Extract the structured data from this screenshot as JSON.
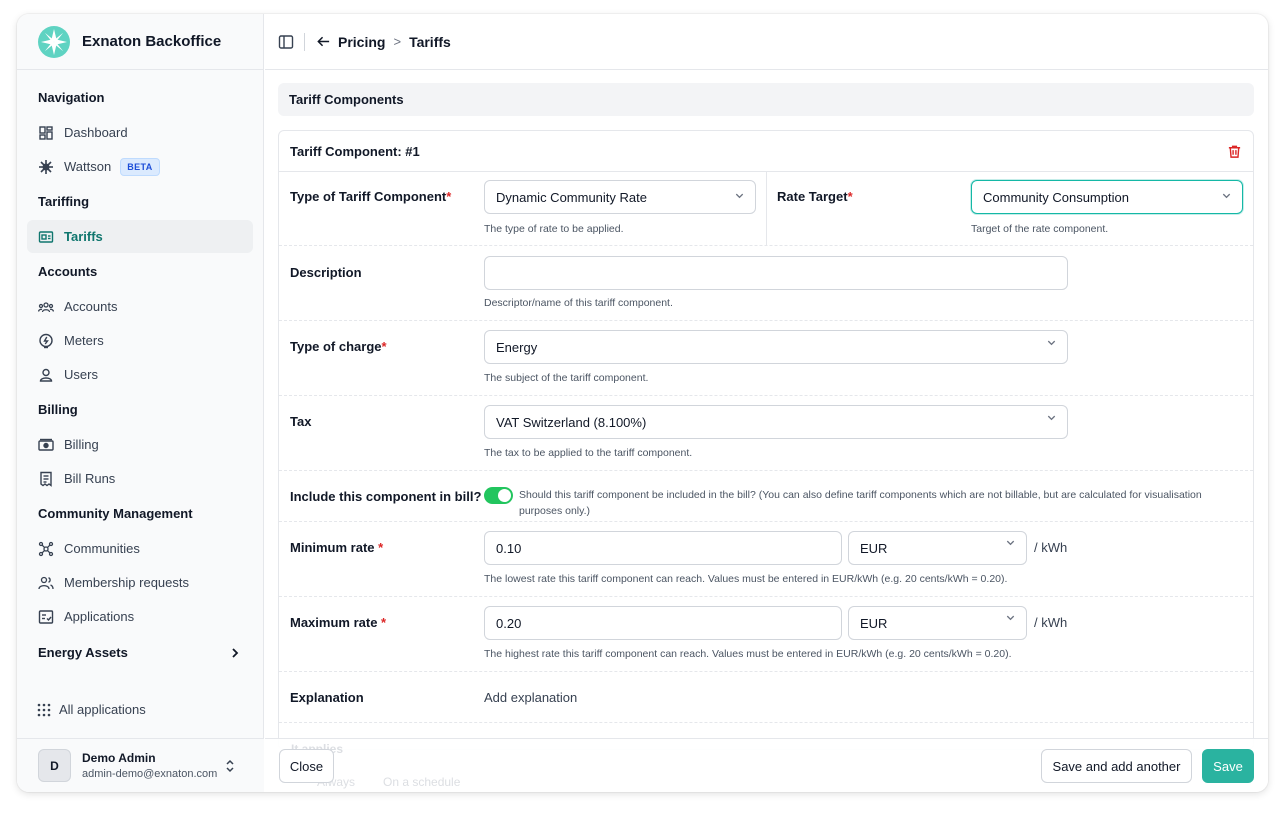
{
  "brand": {
    "name": "Exnaton Backoffice"
  },
  "sidebar": {
    "sections": {
      "navigation": "Navigation",
      "tariffing": "Tariffing",
      "accounts": "Accounts",
      "billing": "Billing",
      "community": "Community Management",
      "energy": "Energy Assets"
    },
    "items": {
      "dashboard": "Dashboard",
      "wattson": "Wattson",
      "wattson_badge": "BETA",
      "tariffs": "Tariffs",
      "accounts": "Accounts",
      "meters": "Meters",
      "users": "Users",
      "billing": "Billing",
      "bill_runs": "Bill Runs",
      "communities": "Communities",
      "membership_requests": "Membership requests",
      "applications": "Applications"
    },
    "all_apps": "All applications",
    "user": {
      "initial": "D",
      "name": "Demo Admin",
      "email": "admin-demo@exnaton.com"
    },
    "accent_color": "#0f766e"
  },
  "topbar": {
    "crumb_parent": "Pricing",
    "crumb_sep": ">",
    "crumb_current": "Tariffs"
  },
  "section": {
    "title": "Tariff Components"
  },
  "component": {
    "title": "Tariff Component: #1",
    "type": {
      "label": "Type of Tariff Component",
      "value": "Dynamic Community Rate",
      "help": "The type of rate to be applied."
    },
    "rate_target": {
      "label": "Rate Target",
      "value": "Community Consumption",
      "help": "Target of the rate component."
    },
    "description": {
      "label": "Description",
      "value": "",
      "help": "Descriptor/name of this tariff component."
    },
    "charge": {
      "label": "Type of charge",
      "value": "Energy",
      "help": "The subject of the tariff component."
    },
    "tax": {
      "label": "Tax",
      "value": "VAT Switzerland (8.100%)",
      "help": "The tax to be applied to the tariff component."
    },
    "include": {
      "label": "Include this component in bill?",
      "enabled": true,
      "help": "Should this tariff component be included in the bill? (You can also define tariff components which are not billable, but are calculated for visualisation purposes only.)"
    },
    "min_rate": {
      "label": "Minimum rate",
      "value": "0.10",
      "currency": "EUR",
      "unit": "/ kWh",
      "help": "The lowest rate this tariff component can reach. Values must be entered in EUR/kWh (e.g. 20 cents/kWh = 0.20)."
    },
    "max_rate": {
      "label": "Maximum rate",
      "value": "0.20",
      "currency": "EUR",
      "unit": "/ kWh",
      "help": "The highest rate this tariff component can reach. Values must be entered in EUR/kWh (e.g. 20 cents/kWh = 0.20)."
    },
    "explanation": {
      "label": "Explanation",
      "action": "Add explanation"
    },
    "required_mark": "*"
  },
  "footer": {
    "ghost_label": "It applies",
    "ghost_opt1": "Always",
    "ghost_opt2": "On a schedule",
    "close": "Close",
    "save_add": "Save and add another",
    "save": "Save",
    "primary_color": "#2ab3a0"
  }
}
